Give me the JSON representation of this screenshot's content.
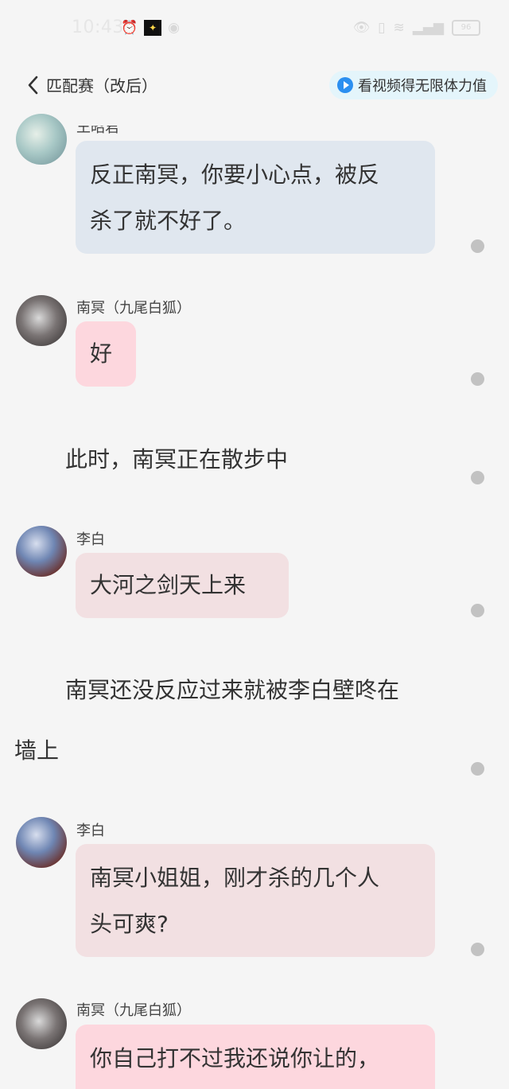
{
  "status_bar": {
    "time": "10:43",
    "battery": "96"
  },
  "header": {
    "title": "匹配赛（改后）",
    "promo": "看视频得无限体力值"
  },
  "messages": [
    {
      "name": "王昭君",
      "text_lines": [
        "反正南冥，你要小心点，被反",
        "杀了就不好了。"
      ]
    },
    {
      "name": "南冥（九尾白狐）",
      "text_lines": [
        "好"
      ]
    },
    {
      "narration": "此时，南冥正在散步中"
    },
    {
      "name": "李白",
      "text_lines": [
        "大河之剑天上来"
      ]
    },
    {
      "narration_lines": [
        "南冥还没反应过来就被李白壁咚在",
        "墙上"
      ]
    },
    {
      "name": "李白",
      "text_lines": [
        "南冥小姐姐，刚才杀的几个人",
        "头可爽?"
      ]
    },
    {
      "name": "南冥（九尾白狐）",
      "text_lines": [
        "你自己打不过我还说你让的，"
      ]
    }
  ]
}
